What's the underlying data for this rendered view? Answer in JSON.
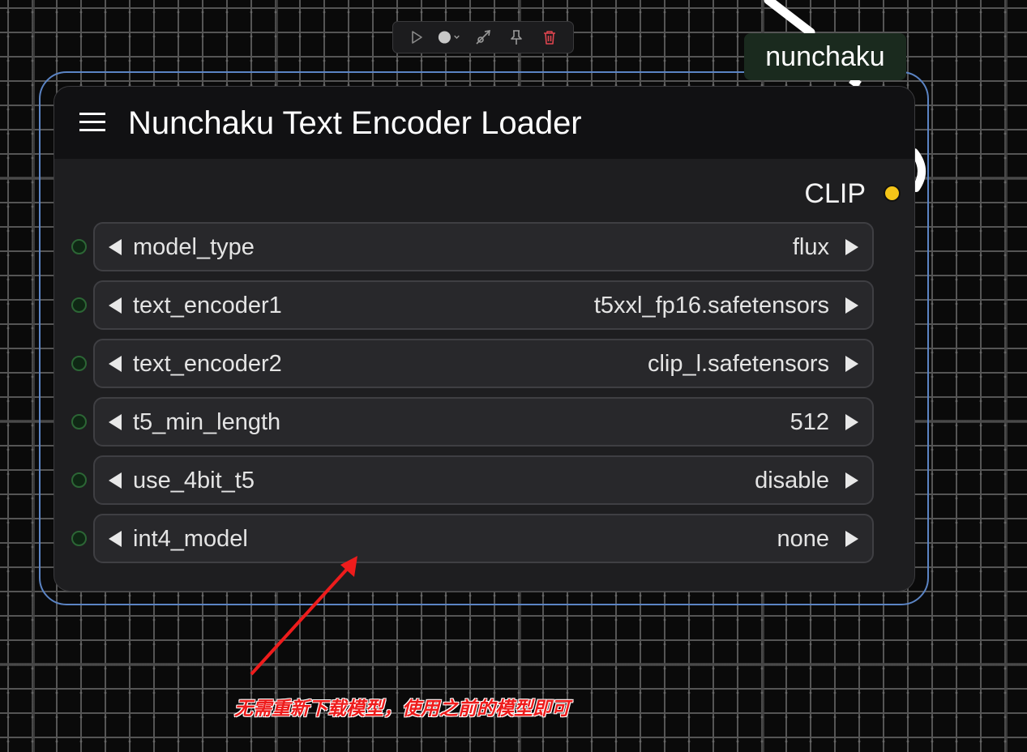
{
  "toolbar": {
    "icons": [
      "play-icon",
      "color-circle-icon",
      "bypass-icon",
      "pin-icon",
      "delete-icon"
    ]
  },
  "badge": {
    "label": "nunchaku"
  },
  "node": {
    "title": "Nunchaku Text Encoder Loader",
    "output": {
      "label": "CLIP",
      "color": "#f5c518"
    },
    "widgets": [
      {
        "name": "model_type",
        "value": "flux"
      },
      {
        "name": "text_encoder1",
        "value": "t5xxl_fp16.safetensors"
      },
      {
        "name": "text_encoder2",
        "value": "clip_l.safetensors"
      },
      {
        "name": "t5_min_length",
        "value": "512"
      },
      {
        "name": "use_4bit_t5",
        "value": "disable"
      },
      {
        "name": "int4_model",
        "value": "none"
      }
    ]
  },
  "annotation": {
    "text": "无需重新下载模型，使用之前的模型即可",
    "color": "#ee1c1c"
  },
  "colors": {
    "selection_border": "#5b84c4",
    "node_bg": "#1e1e20",
    "header_bg": "#111113",
    "slot_ring": "#2c6635"
  }
}
